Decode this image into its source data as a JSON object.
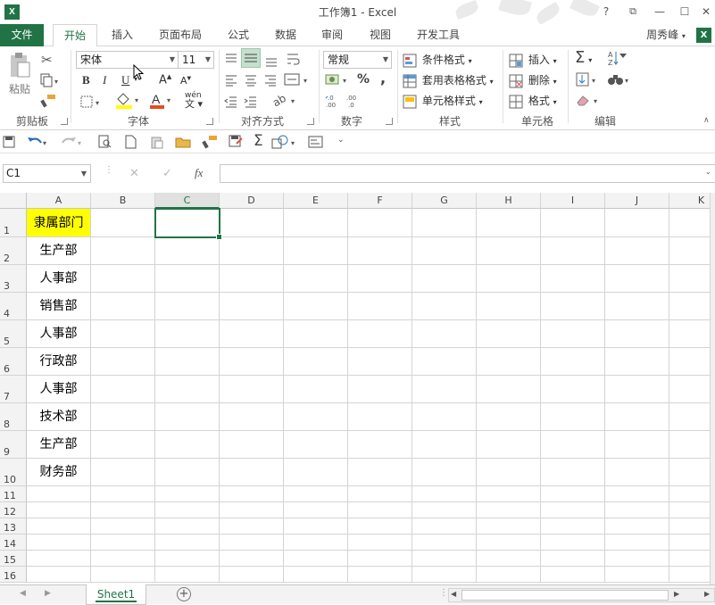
{
  "title": "工作簿1 - Excel",
  "window": {
    "help": "?",
    "restore": "⧉",
    "minimize": "—",
    "maximize": "☐",
    "close": "✕"
  },
  "tabs": [
    "文件",
    "开始",
    "插入",
    "页面布局",
    "公式",
    "数据",
    "审阅",
    "视图",
    "开发工具"
  ],
  "user": "周秀峰",
  "ribbon": {
    "clipboard": {
      "paste": "粘贴",
      "group": "剪贴板"
    },
    "font": {
      "name": "宋体",
      "size": "11",
      "bold": "B",
      "italic": "I",
      "underline": "U",
      "group": "字体",
      "font_color": "A",
      "grow": "A",
      "shrink": "A",
      "phonetic": "wén"
    },
    "alignment": {
      "group": "对齐方式"
    },
    "number": {
      "format": "常规",
      "percent": "%",
      "comma": ",",
      "group": "数字"
    },
    "styles": {
      "conditional": "条件格式",
      "table": "套用表格格式",
      "cell": "单元格样式",
      "group": "样式"
    },
    "cells": {
      "insert": "插入",
      "delete": "删除",
      "format": "格式",
      "group": "单元格"
    },
    "editing": {
      "group": "编辑"
    }
  },
  "formula_bar": {
    "name_box": "C1",
    "cancel": "✕",
    "enter": "✓",
    "fx": "fx",
    "formula": ""
  },
  "columns": [
    "A",
    "B",
    "C",
    "D",
    "E",
    "F",
    "G",
    "H",
    "I",
    "J",
    "K"
  ],
  "selected_column": "C",
  "rows": [
    "1",
    "2",
    "3",
    "4",
    "5",
    "6",
    "7",
    "8",
    "9",
    "10",
    "11",
    "12",
    "13",
    "14",
    "15",
    "16"
  ],
  "column_a": [
    "隶属部门",
    "生产部",
    "人事部",
    "销售部",
    "人事部",
    "行政部",
    "人事部",
    "技术部",
    "生产部",
    "财务部"
  ],
  "colors": {
    "accent": "#217346",
    "header_fill": "#ffff00"
  },
  "sheet": {
    "name": "Sheet1",
    "add": "+"
  }
}
